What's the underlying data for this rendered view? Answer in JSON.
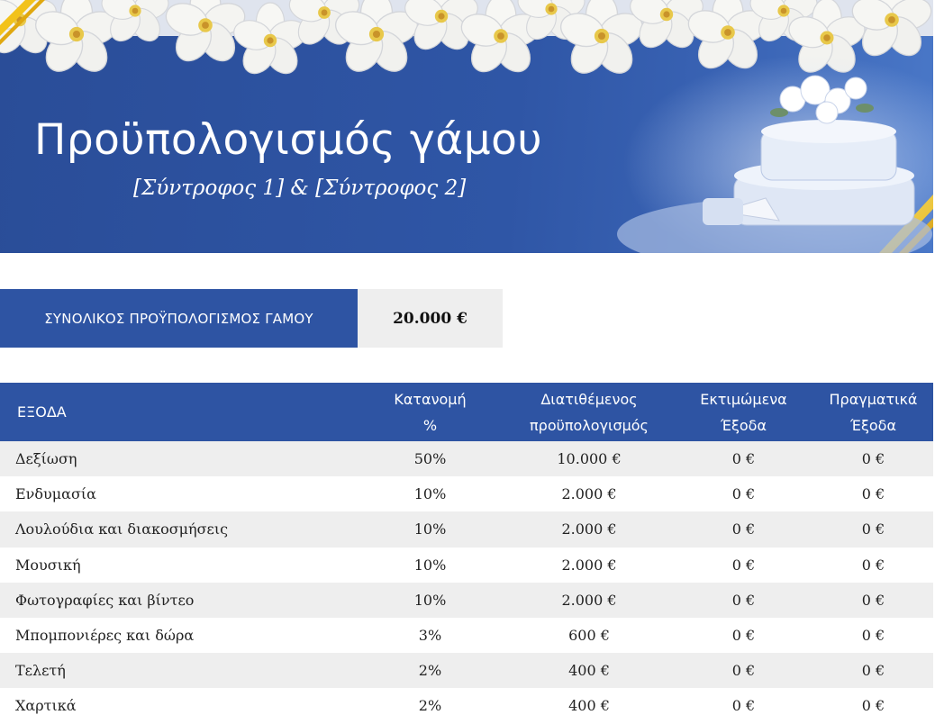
{
  "banner": {
    "title": "Προϋπολογισμός γάμου",
    "subtitle": "[Σύντροφος 1] & [Σύντροφος 2]",
    "background_color": "#2e54a3",
    "ribbon_color": "#f2c21b"
  },
  "total": {
    "label": "ΣΥΝΟΛΙΚΟΣ ΠΡΟΫΠΟΛΟΓΙΣΜΟΣ ΓΑΜΟΥ",
    "value": "20.000 €"
  },
  "table": {
    "headers": [
      "ΕΞΟΔΑ",
      "Κατανομή\n%",
      "Διατιθέμενος\nπροϋπολογισμός",
      "Εκτιμώμενα\nΈξοδα",
      "Πραγματικά\nΈξοδα"
    ],
    "rows": [
      {
        "name": "Δεξίωση",
        "allocation": "50%",
        "budget": "10.000 €",
        "estimated": "0 €",
        "actual": "0 €"
      },
      {
        "name": "Ενδυμασία",
        "allocation": "10%",
        "budget": "2.000 €",
        "estimated": "0 €",
        "actual": "0 €"
      },
      {
        "name": "Λουλούδια και διακοσμήσεις",
        "allocation": "10%",
        "budget": "2.000 €",
        "estimated": "0 €",
        "actual": "0 €"
      },
      {
        "name": "Μουσική",
        "allocation": "10%",
        "budget": "2.000 €",
        "estimated": "0 €",
        "actual": "0 €"
      },
      {
        "name": "Φωτογραφίες και βίντεο",
        "allocation": "10%",
        "budget": "2.000 €",
        "estimated": "0 €",
        "actual": "0 €"
      },
      {
        "name": "Μπομπονιέρες και δώρα",
        "allocation": "3%",
        "budget": "600 €",
        "estimated": "0 €",
        "actual": "0 €"
      },
      {
        "name": "Τελετή",
        "allocation": "2%",
        "budget": "400 €",
        "estimated": "0 €",
        "actual": "0 €"
      },
      {
        "name": "Χαρτικά",
        "allocation": "2%",
        "budget": "400 €",
        "estimated": "0 €",
        "actual": "0 €"
      }
    ]
  }
}
